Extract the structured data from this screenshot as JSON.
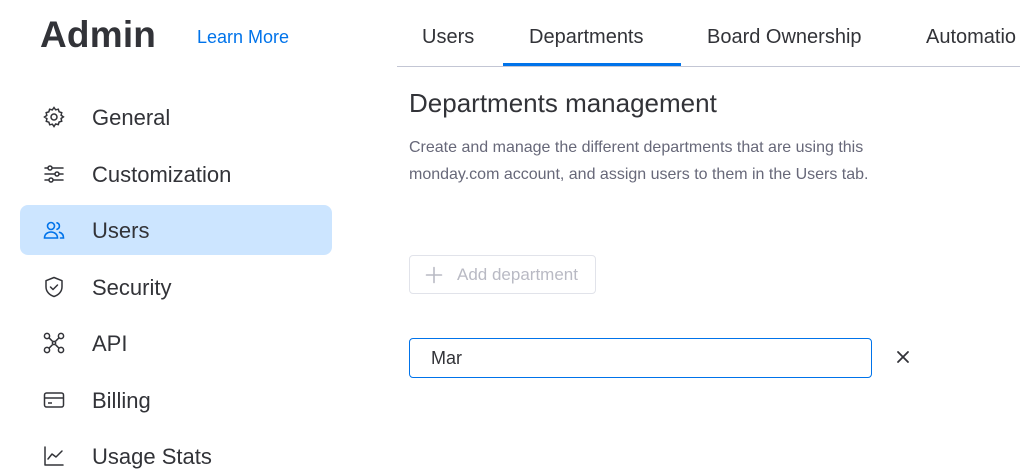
{
  "header": {
    "title": "Admin",
    "learn_more": "Learn More"
  },
  "sidebar": {
    "items": [
      {
        "label": "General",
        "icon": "gear-icon"
      },
      {
        "label": "Customization",
        "icon": "sliders-icon"
      },
      {
        "label": "Users",
        "icon": "users-icon",
        "active": true
      },
      {
        "label": "Security",
        "icon": "shield-icon"
      },
      {
        "label": "API",
        "icon": "api-icon"
      },
      {
        "label": "Billing",
        "icon": "credit-card-icon"
      },
      {
        "label": "Usage Stats",
        "icon": "chart-icon"
      }
    ]
  },
  "tabs": [
    {
      "label": "Users"
    },
    {
      "label": "Departments",
      "active": true
    },
    {
      "label": "Board Ownership"
    },
    {
      "label": "Automatio"
    }
  ],
  "main": {
    "title": "Departments management",
    "description": "Create and manage the different departments that are using this monday.com account, and assign users to them in the Users tab.",
    "add_department": "Add department",
    "input_value": "Mar"
  },
  "colors": {
    "accent": "#0073ea",
    "active_bg": "#cce5ff",
    "text": "#323338",
    "muted": "#676879"
  }
}
